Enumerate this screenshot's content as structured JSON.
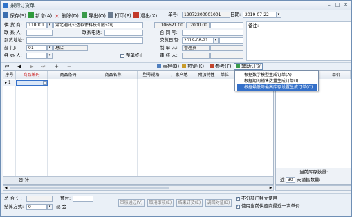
{
  "window": {
    "title": "采购订货单"
  },
  "toolbar": {
    "save": "保存(S)",
    "add": "新增(A)",
    "delete": "删除(D)",
    "export": "导出(O)",
    "print": "打印(P)",
    "exit": "退出(X)"
  },
  "header": {
    "order_no_label": "单号:",
    "order_no": "19072200001001",
    "date_label": "日期:",
    "date": "2019-07-22",
    "note_label": "备注:"
  },
  "form": {
    "supplier_label": "供 货 商:",
    "supplier_code": "110001",
    "supplier_name": "湖北通讯公达软件科技有限公司",
    "amount1": "106621.00",
    "amount2": "2000.00",
    "contact_label": "联 系 人:",
    "contact_phone_label": "联系电话:",
    "contract_label": "合 同 号:",
    "address_label": "到货地址:",
    "delivery_date_label": "交货日期:",
    "delivery_date": "2019-08-21",
    "dept_label": "部   门:",
    "dept_code": "01",
    "dept_name": "总店",
    "maker_label": "制 单 人:",
    "maker": "管理员",
    "handler_label": "经 办 人:",
    "terminate_label": "整单终止",
    "reviewer_label": "审 核 人:"
  },
  "subbar": {
    "form_label": "表栏(B)",
    "hotkey_label": "热键(K)",
    "ref_label": "参考(F)",
    "assist_label": "辅助订货"
  },
  "assist_menu": {
    "items": [
      "根据数学模型生成订单(A)",
      "根据期间销售数量生成订单(I)",
      "根据最低与最高库存设置生成订单(O)"
    ],
    "selected_index": 2
  },
  "grid": {
    "columns": [
      "序号",
      "商品编码",
      "商品条码",
      "商品名称",
      "型号规格",
      "厂家产地",
      "附加特性",
      "单位"
    ],
    "first_row_index": "1",
    "total_label": "合 计"
  },
  "right_panel": {
    "unit_price_header": "单价",
    "stock_label": "当前库存数量:",
    "sales_prefix": "近",
    "sales_days": "30",
    "sales_suffix": "天销售数量:"
  },
  "bottom": {
    "total_amount_label": "总 合 计:",
    "prepay_label": "预付:",
    "settle_label": "结算方式:",
    "settle_code": "0",
    "settle_name": "现 金",
    "btn_review": "审核通过(V)",
    "btn_cancel_review": "取消审核(E)",
    "btn_finish": "结束订货(E)",
    "btn_back": "调回对证(B)",
    "opt_separate_label": "不分部门独立使用",
    "opt_lastprice_label": "使用当前供应商最近一次单价"
  }
}
